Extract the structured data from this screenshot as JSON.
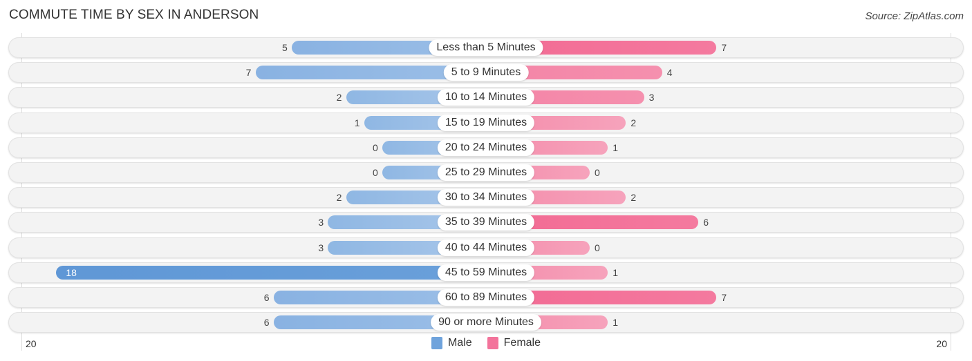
{
  "chart_data": {
    "type": "bar",
    "orientation": "horizontal-diverging",
    "title": "COMMUTE TIME BY SEX IN ANDERSON",
    "source": "Source: ZipAtlas.com",
    "categories": [
      "Less than 5 Minutes",
      "5 to 9 Minutes",
      "10 to 14 Minutes",
      "15 to 19 Minutes",
      "20 to 24 Minutes",
      "25 to 29 Minutes",
      "30 to 34 Minutes",
      "35 to 39 Minutes",
      "40 to 44 Minutes",
      "45 to 59 Minutes",
      "60 to 89 Minutes",
      "90 or more Minutes"
    ],
    "series": [
      {
        "name": "Male",
        "color": "#6fa3dc",
        "values": [
          5,
          7,
          2,
          1,
          0,
          0,
          2,
          3,
          3,
          18,
          6,
          6
        ]
      },
      {
        "name": "Female",
        "color": "#f3739b",
        "values": [
          7,
          4,
          3,
          2,
          1,
          0,
          2,
          6,
          0,
          1,
          7,
          1
        ]
      }
    ],
    "axis": {
      "left_label": "20",
      "right_label": "20",
      "range": [
        -20,
        20
      ]
    },
    "legend": {
      "position": "bottom-center",
      "items": [
        "Male",
        "Female"
      ]
    }
  }
}
